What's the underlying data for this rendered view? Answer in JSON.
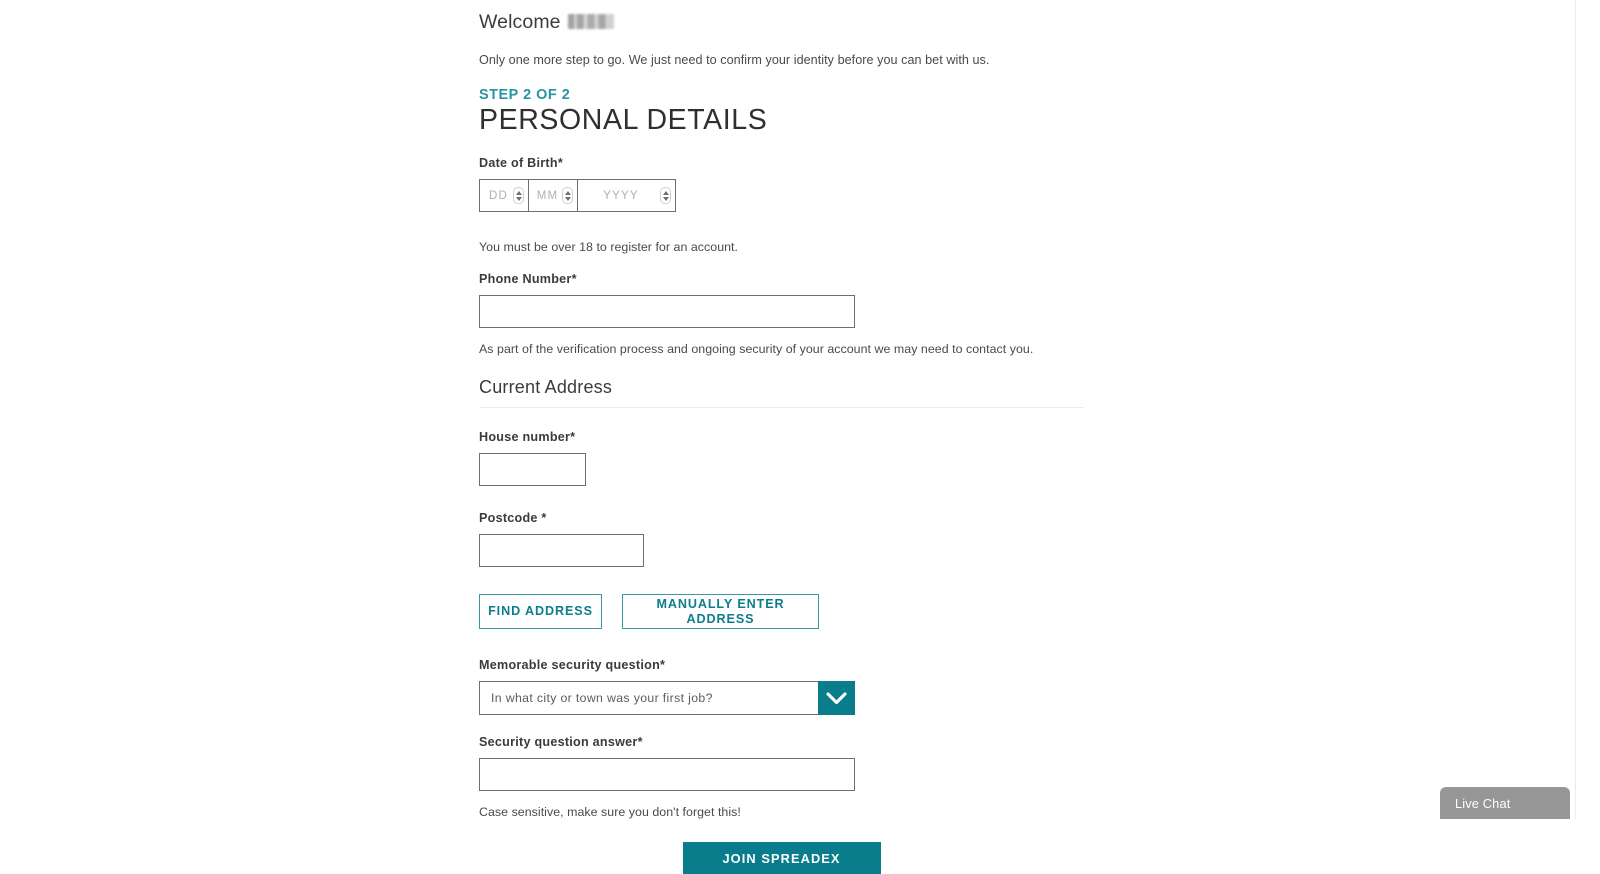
{
  "welcome": {
    "greeting": "Welcome",
    "name_redacted": true,
    "intro": "Only one more step to go. We just need to confirm your identity before you can bet with us."
  },
  "heading": {
    "step": "STEP 2 OF 2",
    "title": "PERSONAL DETAILS"
  },
  "colors": {
    "teal": "#0a7d8c",
    "teal_light": "#2594a3",
    "teal_border": "#3d96a3",
    "live_chat_grey": "#969696"
  },
  "fields": {
    "dob": {
      "label": "Date of Birth*",
      "day_placeholder": "DD",
      "month_placeholder": "MM",
      "year_placeholder": "YYYY",
      "day_value": "",
      "month_value": "",
      "year_value": "",
      "help": "You must be over 18 to register for an account."
    },
    "phone": {
      "label": "Phone Number*",
      "value": "",
      "help": "As part of the verification process and ongoing security of your account we may need to contact you."
    },
    "house_number": {
      "label": "House number*",
      "value": ""
    },
    "postcode": {
      "label": "Postcode *",
      "value": ""
    },
    "security_question": {
      "label": "Memorable security question*",
      "selected": "In what city or town was your first job?"
    },
    "security_answer": {
      "label": "Security question answer*",
      "value": "",
      "help": "Case sensitive, make sure you don't forget this!"
    }
  },
  "sections": {
    "current_address": "Current Address"
  },
  "buttons": {
    "find_address": "FIND ADDRESS",
    "manually_enter_address": "MANUALLY ENTER ADDRESS",
    "submit": "JOIN SPREADEX"
  },
  "widgets": {
    "live_chat": "Live Chat"
  }
}
